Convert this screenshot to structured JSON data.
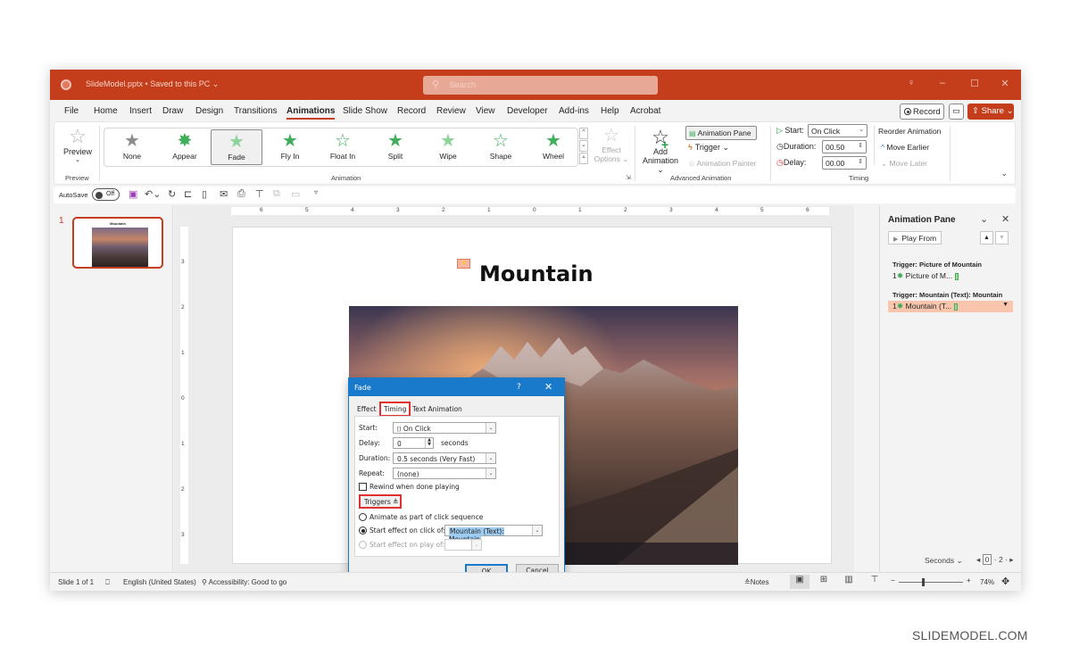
{
  "titlebar": {
    "doc_title": "SlideModel.pptx • Saved to this PC ⌄",
    "search_placeholder": "Search",
    "icons": [
      "lightbulb-icon",
      "minimize-icon",
      "maximize-icon",
      "close-icon"
    ]
  },
  "menu": {
    "tabs": [
      "File",
      "Home",
      "Insert",
      "Draw",
      "Design",
      "Transitions",
      "Animations",
      "Slide Show",
      "Record",
      "Review",
      "View",
      "Developer",
      "Add-ins",
      "Help",
      "Acrobat"
    ],
    "active_tab": "Animations",
    "record_label": "Record",
    "share_label": "Share ⌄"
  },
  "ribbon": {
    "preview": {
      "label": "Preview",
      "group": "Preview"
    },
    "animation_gallery": {
      "items": [
        "None",
        "Appear",
        "Fade",
        "Fly In",
        "Float In",
        "Split",
        "Wipe",
        "Shape",
        "Wheel"
      ],
      "selected": "Fade",
      "group": "Animation"
    },
    "effect_options": {
      "line1": "Effect",
      "line2": "Options ⌄"
    },
    "advanced": {
      "add_animation_1": "Add",
      "add_animation_2": "Animation ⌄",
      "animation_pane": "Animation Pane",
      "trigger": "Trigger ⌄",
      "animation_painter": "Animation Painter",
      "group": "Advanced Animation"
    },
    "timing": {
      "start_label": "Start:",
      "start_value": "On Click",
      "duration_label": "Duration:",
      "duration_value": "00.50",
      "delay_label": "Delay:",
      "delay_value": "00.00",
      "reorder_title": "Reorder Animation",
      "move_earlier": "Move Earlier",
      "move_later": "Move Later",
      "group": "Timing"
    }
  },
  "qat": {
    "autosave_label": "AutoSave",
    "autosave_state": "Off"
  },
  "thumbnails": [
    {
      "number": "1",
      "title": "Mountain"
    }
  ],
  "rulers": {
    "horizontal": [
      "6",
      "5",
      "4",
      "3",
      "2",
      "1",
      "0",
      "1",
      "2",
      "3",
      "4",
      "5",
      "6"
    ],
    "vertical": [
      "3",
      "2",
      "1",
      "0",
      "1",
      "2",
      "3"
    ]
  },
  "slide": {
    "title": "Mountain",
    "anim_tag": "⚡"
  },
  "dialog": {
    "title": "Fade",
    "help": "?",
    "close": "✕",
    "tabs": [
      "Effect",
      "Timing",
      "Text Animation"
    ],
    "active_tab": "Timing",
    "start_label": "Start:",
    "start_value": "On Click",
    "delay_label": "Delay:",
    "delay_value": "0",
    "delay_unit": "seconds",
    "duration_label": "Duration:",
    "duration_value": "0.5 seconds (Very Fast)",
    "repeat_label": "Repeat:",
    "repeat_value": "(none)",
    "rewind_label": "Rewind when done playing",
    "rewind_checked": false,
    "triggers_label": "Triggers ≜",
    "radio_sequence": "Animate as part of click sequence",
    "radio_click": "Start effect on click of:",
    "radio_click_value": "Mountain (Text): Mountain",
    "radio_play": "Start effect on play of:",
    "selected_radio": "Start effect on click of:",
    "ok": "OK",
    "cancel": "Cancel"
  },
  "animation_pane": {
    "title": "Animation Pane",
    "play_from": "Play From",
    "groups": [
      {
        "trigger": "Trigger: Picture of Mountain",
        "item_num": "1",
        "item_label": "Picture of M...",
        "selected": false
      },
      {
        "trigger": "Trigger: Mountain (Text): Mountain",
        "item_num": "1",
        "item_label": "Mountain (T...",
        "selected": true
      }
    ],
    "seconds_label": "Seconds ⌄",
    "timeline_start": "0",
    "timeline_mark": "2"
  },
  "statusbar": {
    "slide_info": "Slide 1 of 1",
    "language": "English (United States)",
    "accessibility": "Accessibility: Good to go",
    "notes": "Notes",
    "zoom_minus": "−",
    "zoom_plus": "+",
    "zoom_level": "74%"
  },
  "watermark": "SLIDEMODEL.COM",
  "colors": {
    "accent": "#c43e1c",
    "dialog_blue": "#1979ca",
    "highlight_red": "#e03030",
    "anim_green": "#3fae5a",
    "pane_selected": "#f9c6ad"
  }
}
